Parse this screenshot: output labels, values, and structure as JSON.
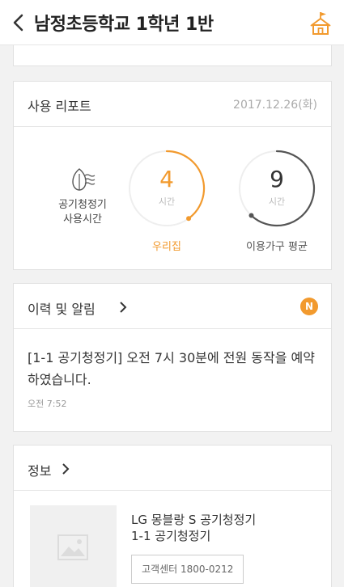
{
  "header": {
    "title": "남정초등학교 1학년 1반"
  },
  "report": {
    "title": "사용 리포트",
    "date": "2017.12.26(화)",
    "purifier_label_line1": "공기청정기",
    "purifier_label_line2": "사용시간",
    "my_home": {
      "value": "4",
      "unit": "시간",
      "label": "우리집",
      "fraction": 0.4,
      "color": "#f29a2e"
    },
    "average": {
      "value": "9",
      "unit": "시간",
      "label": "이용가구 평균",
      "fraction": 0.62,
      "color": "#555555"
    }
  },
  "history": {
    "title": "이력 및 알림",
    "badge": "N",
    "message": "[1-1 공기청정기] 오전 7시 30분에 전원 동작을 예약하였습니다.",
    "time": "오전 7:52"
  },
  "info": {
    "title": "정보",
    "product_line1": "LG 몽블랑 S 공기청정기",
    "product_line2": "1-1 공기청정기",
    "cs_button": "고객센터 1800-0212"
  },
  "colors": {
    "accent": "#f29a2e",
    "dark_arc": "#555555"
  }
}
